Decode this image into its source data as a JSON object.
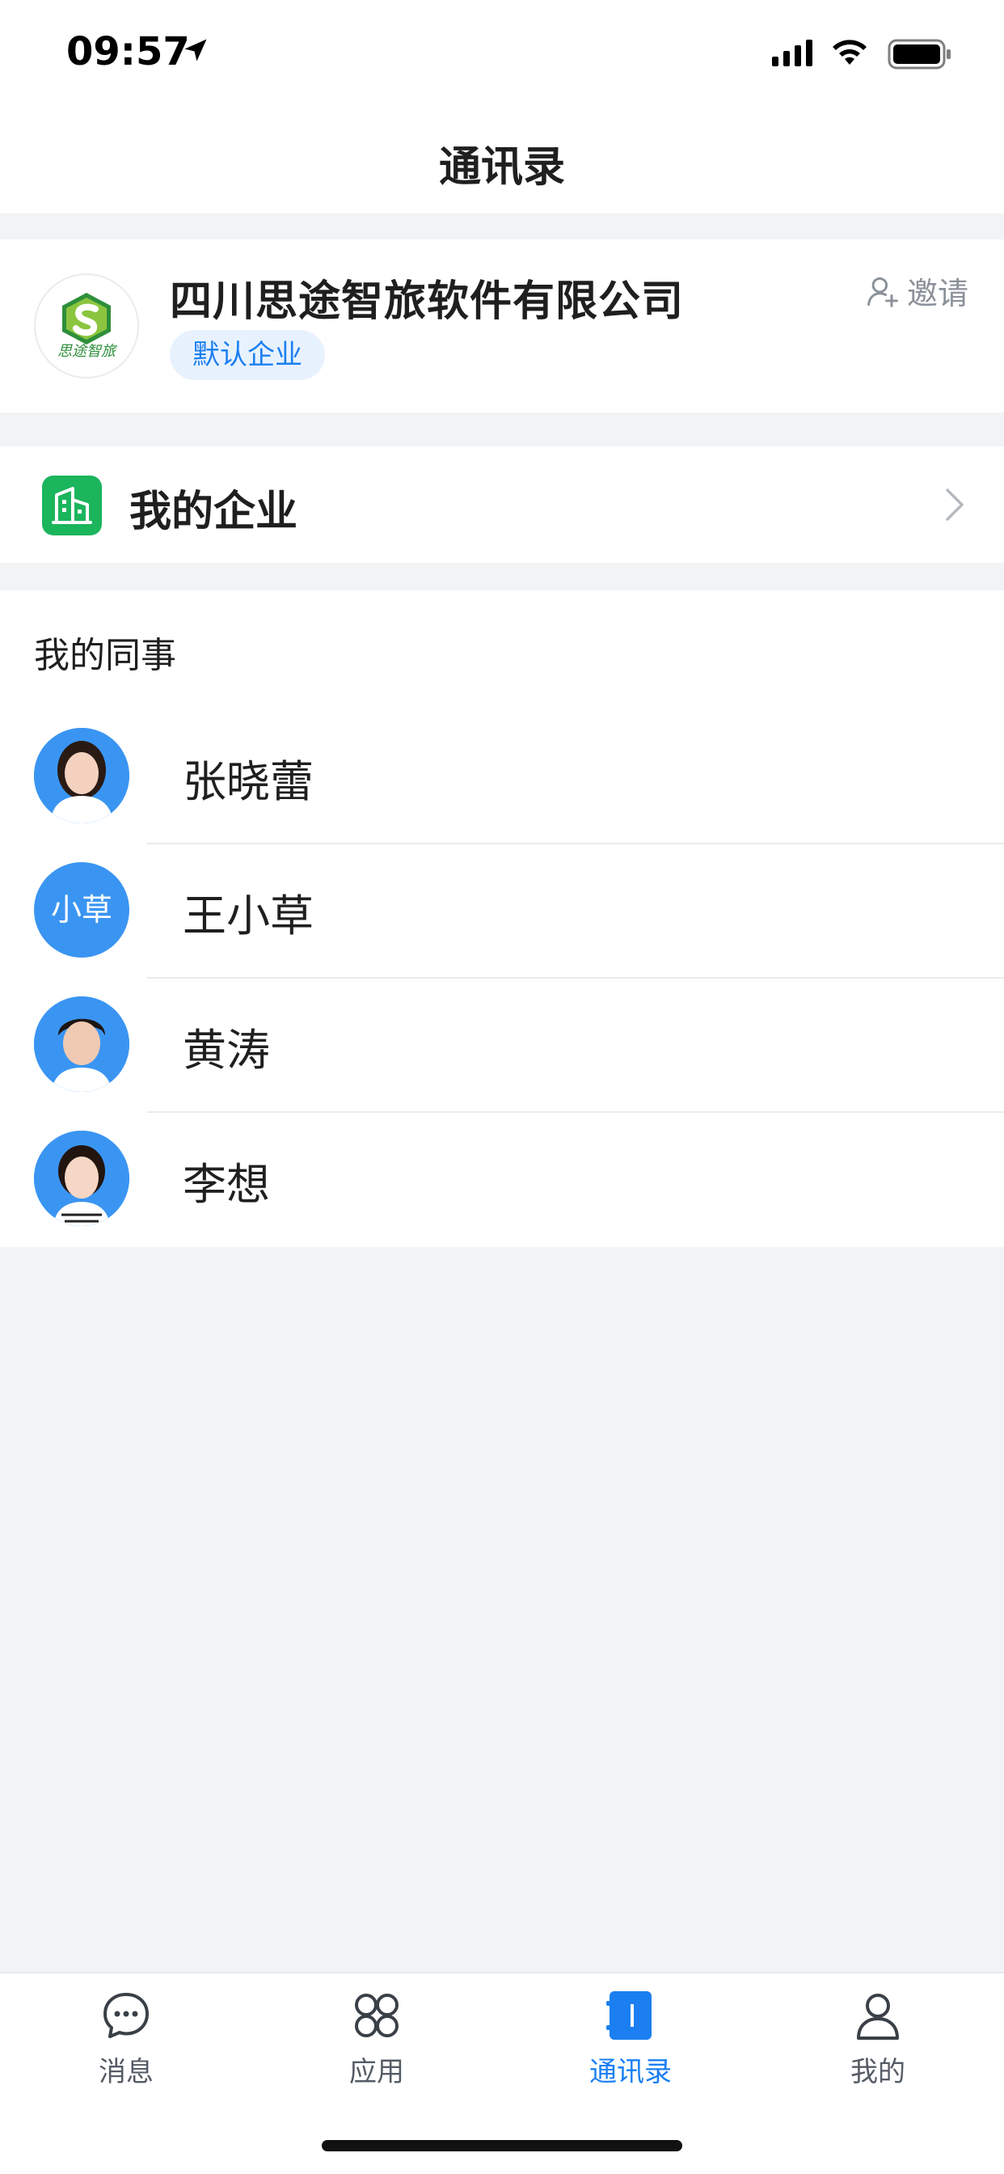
{
  "status_bar": {
    "time": "09:57"
  },
  "nav": {
    "title": "通讯录"
  },
  "company": {
    "logo_text": "思途智旅",
    "name": "四川思途智旅软件有限公司",
    "tag": "默认企业",
    "invite_label": "邀请"
  },
  "enterprise_row": {
    "label": "我的企业"
  },
  "colleagues": {
    "title": "我的同事",
    "people": [
      {
        "name": "张晓蕾",
        "avatar_text": ""
      },
      {
        "name": "王小草",
        "avatar_text": "小草"
      },
      {
        "name": "黄涛",
        "avatar_text": ""
      },
      {
        "name": "李想",
        "avatar_text": ""
      }
    ]
  },
  "tabs": [
    {
      "label": "消息",
      "icon": "message-icon"
    },
    {
      "label": "应用",
      "icon": "apps-icon"
    },
    {
      "label": "通讯录",
      "icon": "contacts-icon",
      "active": true
    },
    {
      "label": "我的",
      "icon": "profile-icon"
    }
  ],
  "colors": {
    "accent": "#1b7ff1",
    "enterprise_green": "#1bb55c",
    "avatar_blue": "#3a95f2"
  }
}
